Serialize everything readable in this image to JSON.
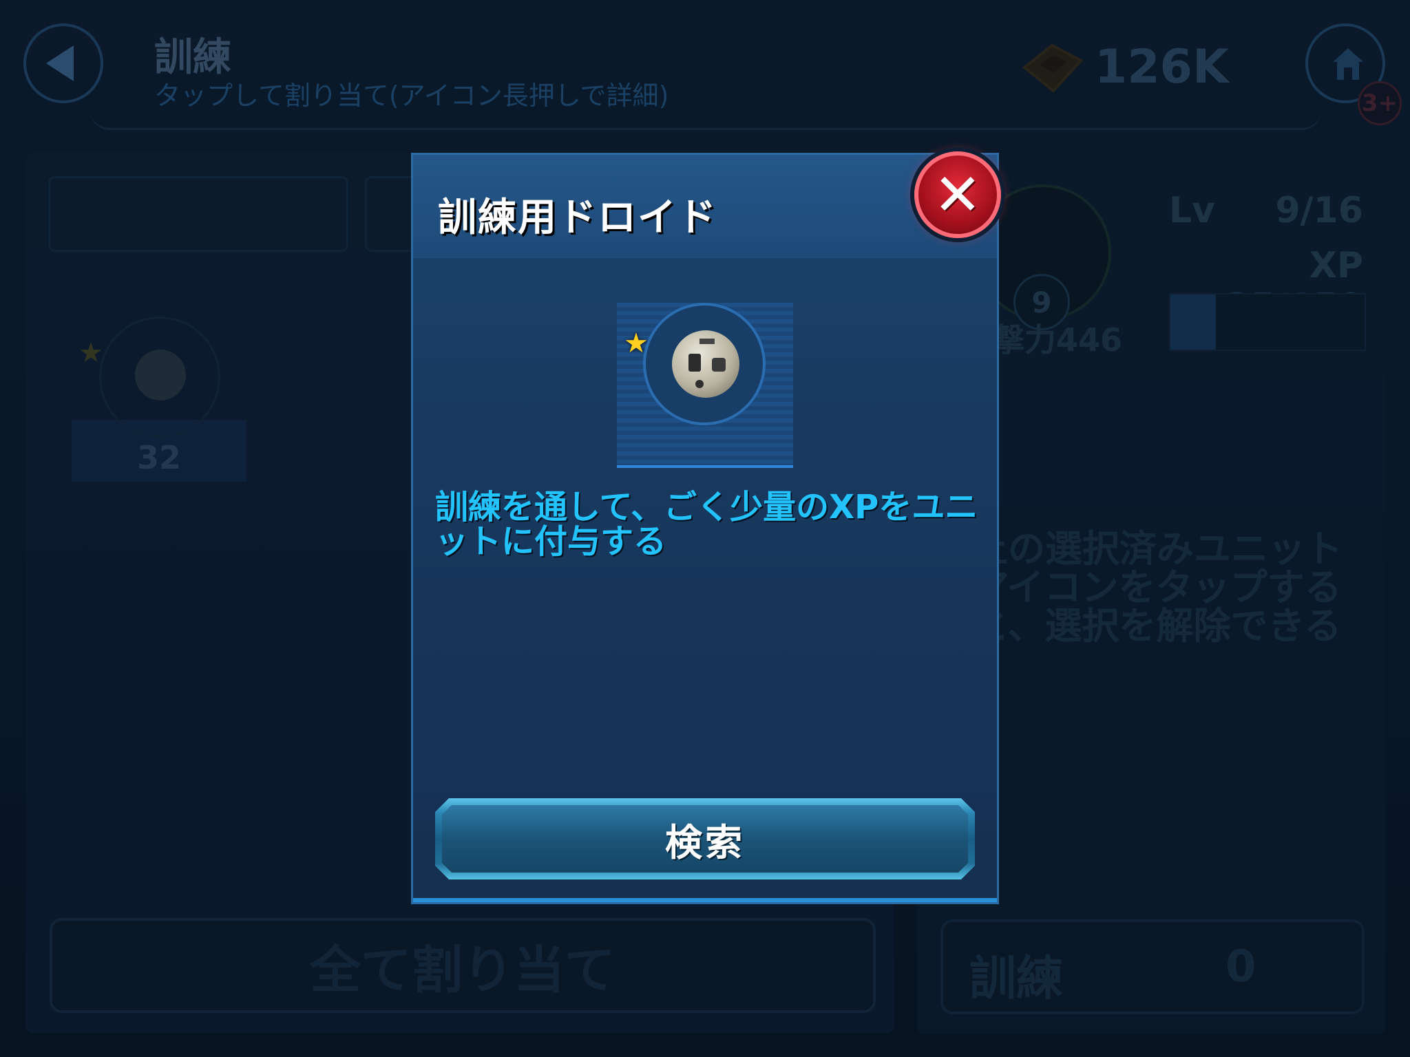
{
  "header": {
    "title": "訓練",
    "subtitle": "タップして割り当て(アイコン長押しで詳細)",
    "currency_amount": "126K",
    "notification_badge": "3+"
  },
  "left_panel": {
    "item_count": "32",
    "assign_all_label": "全て割り当て"
  },
  "unit": {
    "level_badge": "9",
    "power": "攻撃力446",
    "lv_label": "Lv",
    "lv_value": "9/16",
    "xp_text": "XP 35/150",
    "xp_fraction": 0.233,
    "hint": "上の選択済みユニットアイコンをタップすると、選択を解除できる",
    "training_label": "訓練",
    "training_count": "0"
  },
  "modal": {
    "title": "訓練用ドロイド",
    "description": "訓練を通して、ごく少量のXPをユニットに付与する",
    "search_label": "検索",
    "item_stars": 1
  },
  "icons": {
    "back": "back-arrow-icon",
    "home": "home-icon",
    "currency": "credits-icon",
    "close": "close-icon",
    "star": "star-icon",
    "droid": "training-droid-icon"
  },
  "colors": {
    "accent": "#23c3ff",
    "close_red": "#d01c2c",
    "star_gold": "#ffd021"
  }
}
